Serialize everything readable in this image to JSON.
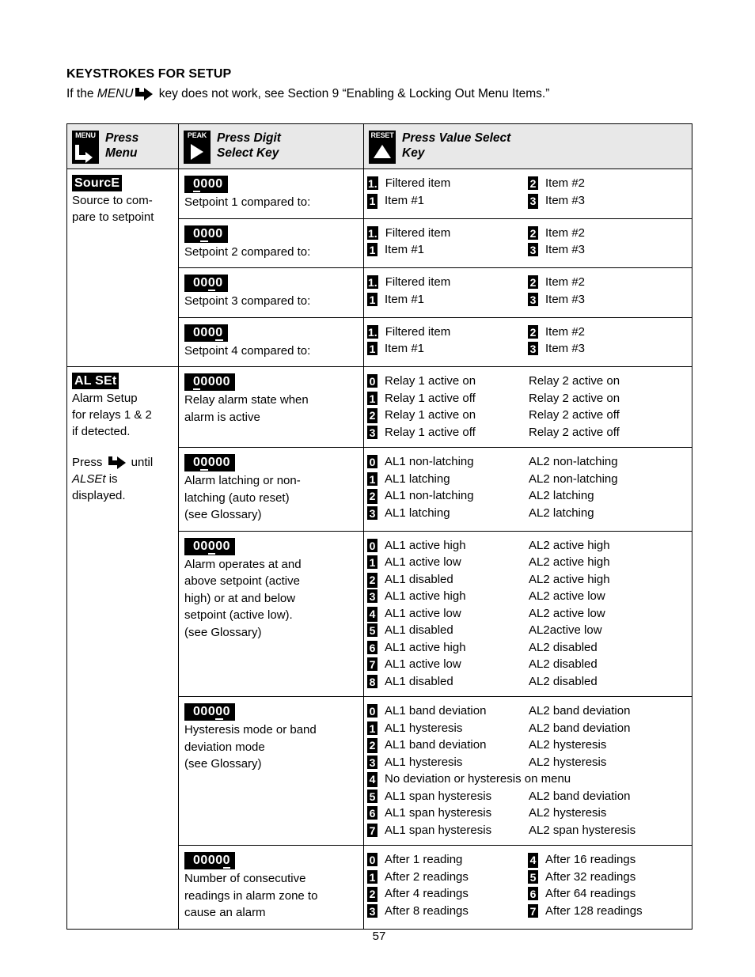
{
  "header": {
    "title": "KEYSTROKES FOR SETUP",
    "note_before": "If the ",
    "note_menu_word": "MENU",
    "note_after": " key does not work, see Section 9 “Enabling & Locking Out Menu Items.”"
  },
  "table_head": {
    "col1": {
      "keycap": "MENU",
      "icon": "menu-arrow-icon",
      "label": "Press\nMenu"
    },
    "col2": {
      "keycap": "PEAK",
      "icon": "play-triangle-icon",
      "label": "Press Digit\nSelect Key"
    },
    "col3": {
      "keycap": "RESET",
      "icon": "up-triangle-icon",
      "label": "Press Value Select\nKey"
    }
  },
  "groups": [
    {
      "menu_tag": "SourcE",
      "desc": "Source to com-\npare to setpoint",
      "note": null,
      "rows": [
        {
          "display": {
            "digits": "0000",
            "selected_index": 0
          },
          "desc": "Setpoint 1 compared to:",
          "layout": "pairs",
          "left": [
            {
              "badge": "1",
              "badge_style": "dot",
              "text": "Filtered item"
            },
            {
              "badge": "1",
              "badge_style": "under",
              "text": "Item #1"
            }
          ],
          "right": [
            {
              "badge": "2",
              "badge_style": "plain",
              "text": "Item #2"
            },
            {
              "badge": "3",
              "badge_style": "under",
              "text": "Item #3"
            }
          ]
        },
        {
          "display": {
            "digits": "0000",
            "selected_index": 1
          },
          "desc": "Setpoint 2 compared to:",
          "layout": "pairs",
          "left": [
            {
              "badge": "1",
              "badge_style": "dot",
              "text": "Filtered item"
            },
            {
              "badge": "1",
              "badge_style": "plain",
              "text": "Item #1"
            }
          ],
          "right": [
            {
              "badge": "2",
              "badge_style": "plain",
              "text": "Item #2"
            },
            {
              "badge": "3",
              "badge_style": "plain",
              "text": "Item #3"
            }
          ]
        },
        {
          "display": {
            "digits": "0000",
            "selected_index": 2
          },
          "desc": "Setpoint 3 compared to:",
          "layout": "pairs",
          "left": [
            {
              "badge": "1",
              "badge_style": "dot",
              "text": "Filtered item"
            },
            {
              "badge": "1",
              "badge_style": "plain",
              "text": "Item #1"
            }
          ],
          "right": [
            {
              "badge": "2",
              "badge_style": "plain",
              "text": "Item #2"
            },
            {
              "badge": "3",
              "badge_style": "plain",
              "text": "Item #3"
            }
          ]
        },
        {
          "display": {
            "digits": "0000",
            "selected_index": 3
          },
          "desc": "Setpoint 4 compared to:",
          "layout": "pairs",
          "left": [
            {
              "badge": "1",
              "badge_style": "dot",
              "text": "Filtered item"
            },
            {
              "badge": "1",
              "badge_style": "plain",
              "text": "Item #1"
            }
          ],
          "right": [
            {
              "badge": "2",
              "badge_style": "plain",
              "text": "Item #2"
            },
            {
              "badge": "3",
              "badge_style": "plain",
              "text": "Item #3"
            }
          ]
        }
      ]
    },
    {
      "menu_tag": "AL SEt",
      "desc": "Alarm Setup\nfor relays 1 & 2\nif detected.",
      "note": {
        "before": "Press ",
        "after": " until",
        "line2_italic": "ALSEt",
        "line2_rest": " is",
        "line3": "displayed."
      },
      "rows": [
        {
          "display": {
            "digits": "00000",
            "selected_index": 0
          },
          "desc": "Relay alarm state when\nalarm is active",
          "layout": "two-col",
          "options": [
            {
              "badge": "0",
              "badge_style": "plain",
              "a": "Relay 1 active on",
              "b": "Relay 2 active on"
            },
            {
              "badge": "1",
              "badge_style": "plain",
              "a": "Relay 1 active off",
              "b": "Relay 2 active on"
            },
            {
              "badge": "2",
              "badge_style": "under",
              "a": "Relay 1 active on",
              "b": "Relay 2 active off"
            },
            {
              "badge": "3",
              "badge_style": "plain",
              "a": "Relay 1 active off",
              "b": "Relay 2 active off"
            }
          ]
        },
        {
          "display": {
            "digits": "00000",
            "selected_index": 1
          },
          "desc": "Alarm latching or non-\nlatching (auto reset)\n(see Glossary)",
          "layout": "two-col",
          "options": [
            {
              "badge": "0",
              "badge_style": "plain",
              "a": "AL1 non-latching",
              "b": "AL2 non-latching"
            },
            {
              "badge": "1",
              "badge_style": "plain",
              "a": "AL1 latching",
              "b": "AL2 non-latching"
            },
            {
              "badge": "2",
              "badge_style": "under",
              "a": "AL1 non-latching",
              "b": "AL2 latching"
            },
            {
              "badge": "3",
              "badge_style": "plain",
              "a": "AL1 latching",
              "b": "AL2 latching"
            }
          ]
        },
        {
          "display": {
            "digits": "00000",
            "selected_index": 2
          },
          "desc": "Alarm operates at and\nabove setpoint (active\nhigh) or at and below\nsetpoint (active low).\n(see Glossary)",
          "layout": "two-col",
          "options": [
            {
              "badge": "0",
              "badge_style": "plain",
              "a": "AL1 active high",
              "b": "AL2 active high"
            },
            {
              "badge": "1",
              "badge_style": "plain",
              "a": "AL1 active low",
              "b": "AL2 active high"
            },
            {
              "badge": "2",
              "badge_style": "under",
              "a": "AL1 disabled",
              "b": "AL2 active high"
            },
            {
              "badge": "3",
              "badge_style": "plain",
              "a": "AL1 active high",
              "b": "AL2 active low"
            },
            {
              "badge": "4",
              "badge_style": "under",
              "a": "AL1 active low",
              "b": "AL2 active low"
            },
            {
              "badge": "5",
              "badge_style": "plain",
              "a": "AL1 disabled",
              "b": "AL2active low"
            },
            {
              "badge": "6",
              "badge_style": "plain",
              "a": "AL1 active high",
              "b": "AL2 disabled"
            },
            {
              "badge": "7",
              "badge_style": "plain",
              "a": "AL1 active low",
              "b": "AL2 disabled"
            },
            {
              "badge": "8",
              "badge_style": "plain",
              "a": "AL1 disabled",
              "b": "AL2 disabled"
            }
          ]
        },
        {
          "display": {
            "digits": "00000",
            "selected_index": 3
          },
          "desc": "Hysteresis mode or band\ndeviation mode\n(see Glossary)",
          "layout": "two-col",
          "options": [
            {
              "badge": "0",
              "badge_style": "plain",
              "a": "AL1 band deviation",
              "b": "AL2 band deviation"
            },
            {
              "badge": "1",
              "badge_style": "plain",
              "a": "AL1 hysteresis",
              "b": "AL2 band deviation"
            },
            {
              "badge": "2",
              "badge_style": "under",
              "a": "AL1 band deviation",
              "b": "AL2 hysteresis"
            },
            {
              "badge": "3",
              "badge_style": "plain",
              "a": "AL1 hysteresis",
              "b": "AL2 hysteresis"
            },
            {
              "badge": "4",
              "badge_style": "under",
              "a": "No deviation or hysteresis on menu",
              "b": "",
              "span": true
            },
            {
              "badge": "5",
              "badge_style": "plain",
              "a": "AL1 span hysteresis",
              "b": "AL2 band deviation"
            },
            {
              "badge": "6",
              "badge_style": "plain",
              "a": "AL1 span hysteresis",
              "b": "AL2 hysteresis"
            },
            {
              "badge": "7",
              "badge_style": "plain",
              "a": "AL1 span hysteresis",
              "b": "AL2 span hysteresis"
            }
          ]
        },
        {
          "display": {
            "digits": "00000",
            "selected_index": 4
          },
          "desc": "Number of consecutive\nreadings in alarm zone to\ncause an alarm",
          "layout": "pairs",
          "left": [
            {
              "badge": "0",
              "badge_style": "plain",
              "text": "After 1 reading"
            },
            {
              "badge": "1",
              "badge_style": "plain",
              "text": "After 2 readings"
            },
            {
              "badge": "2",
              "badge_style": "under",
              "text": "After 4 readings"
            },
            {
              "badge": "3",
              "badge_style": "plain",
              "text": "After 8 readings"
            }
          ],
          "right": [
            {
              "badge": "4",
              "badge_style": "under",
              "text": "After 16 readings"
            },
            {
              "badge": "5",
              "badge_style": "plain",
              "text": "After 32 readings"
            },
            {
              "badge": "6",
              "badge_style": "plain",
              "text": "After 64 readings"
            },
            {
              "badge": "7",
              "badge_style": "plain",
              "text": "After 128 readings"
            }
          ]
        }
      ]
    }
  ],
  "footer": {
    "page_number": "57"
  }
}
